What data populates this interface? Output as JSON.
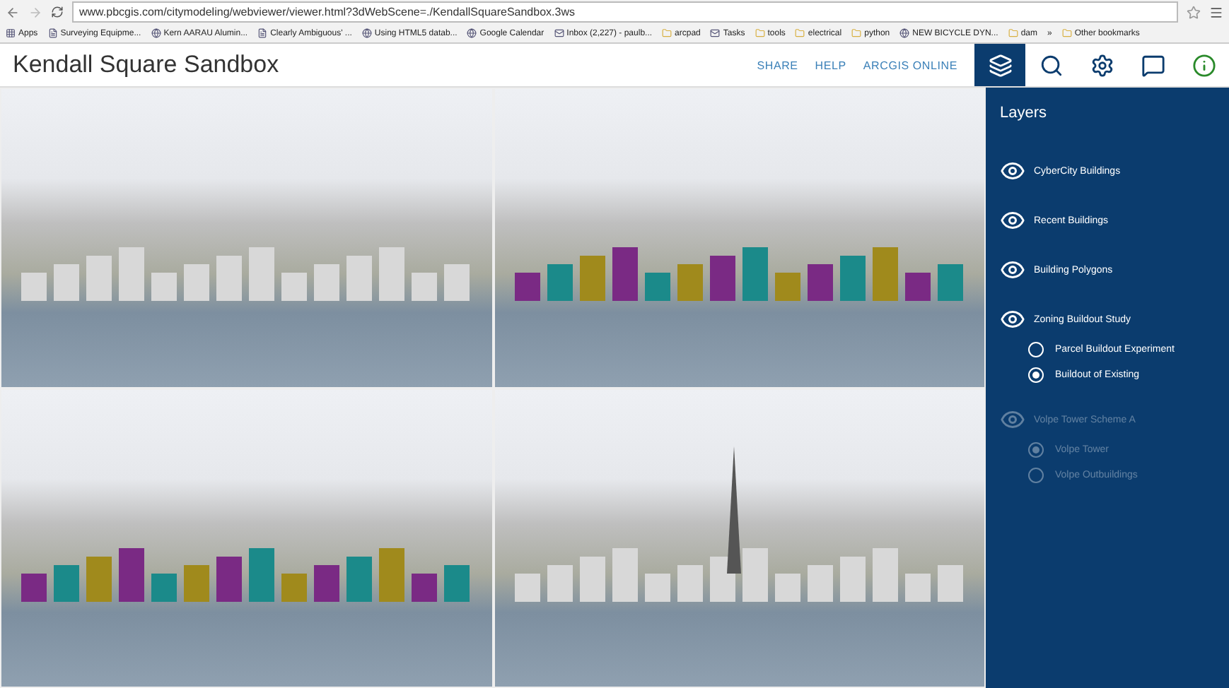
{
  "browser": {
    "url": "www.pbcgis.com/citymodeling/webviewer/viewer.html?3dWebScene=./KendallSquareSandbox.3ws",
    "bookmarks": [
      {
        "label": "Apps",
        "kind": "apps"
      },
      {
        "label": "Surveying Equipme...",
        "kind": "page"
      },
      {
        "label": "Kern AARAU Alumin...",
        "kind": "site"
      },
      {
        "label": "Clearly Ambiguous' ...",
        "kind": "page"
      },
      {
        "label": "Using HTML5 datab...",
        "kind": "site"
      },
      {
        "label": "Google Calendar",
        "kind": "site"
      },
      {
        "label": "Inbox (2,227) - paulb...",
        "kind": "mail"
      },
      {
        "label": "arcpad",
        "kind": "folder"
      },
      {
        "label": "Tasks",
        "kind": "mail"
      },
      {
        "label": "tools",
        "kind": "folder"
      },
      {
        "label": "electrical",
        "kind": "folder"
      },
      {
        "label": "python",
        "kind": "folder"
      },
      {
        "label": "NEW BICYCLE DYN...",
        "kind": "site"
      },
      {
        "label": "dam",
        "kind": "folder"
      },
      {
        "label": "»",
        "kind": "more"
      },
      {
        "label": "Other bookmarks",
        "kind": "folder"
      }
    ]
  },
  "app": {
    "title": "Kendall Square Sandbox",
    "links": [
      "SHARE",
      "HELP",
      "ARCGIS ONLINE"
    ],
    "tools": [
      {
        "kind": "layers",
        "selected": true
      },
      {
        "kind": "search",
        "selected": false
      },
      {
        "kind": "settings",
        "selected": false
      },
      {
        "kind": "chat",
        "selected": false
      },
      {
        "kind": "info",
        "selected": false
      }
    ]
  },
  "views": [
    {
      "kind": "plain"
    },
    {
      "kind": "zoning"
    },
    {
      "kind": "zoning-close"
    },
    {
      "kind": "tower"
    }
  ],
  "panel": {
    "title": "Layers",
    "layers": [
      {
        "label": "CyberCity Buildings",
        "disabled": false
      },
      {
        "label": "Recent Buildings",
        "disabled": false
      },
      {
        "label": "Building Polygons",
        "disabled": false
      },
      {
        "label": "Zoning Buildout Study",
        "disabled": false,
        "options": [
          {
            "label": "Parcel Buildout Experiment",
            "selected": false
          },
          {
            "label": "Buildout of Existing",
            "selected": true
          }
        ]
      },
      {
        "label": "Volpe Tower Scheme A",
        "disabled": true,
        "options": [
          {
            "label": "Volpe Tower",
            "selected": true
          },
          {
            "label": "Volpe Outbuildings",
            "selected": false
          }
        ]
      }
    ]
  }
}
